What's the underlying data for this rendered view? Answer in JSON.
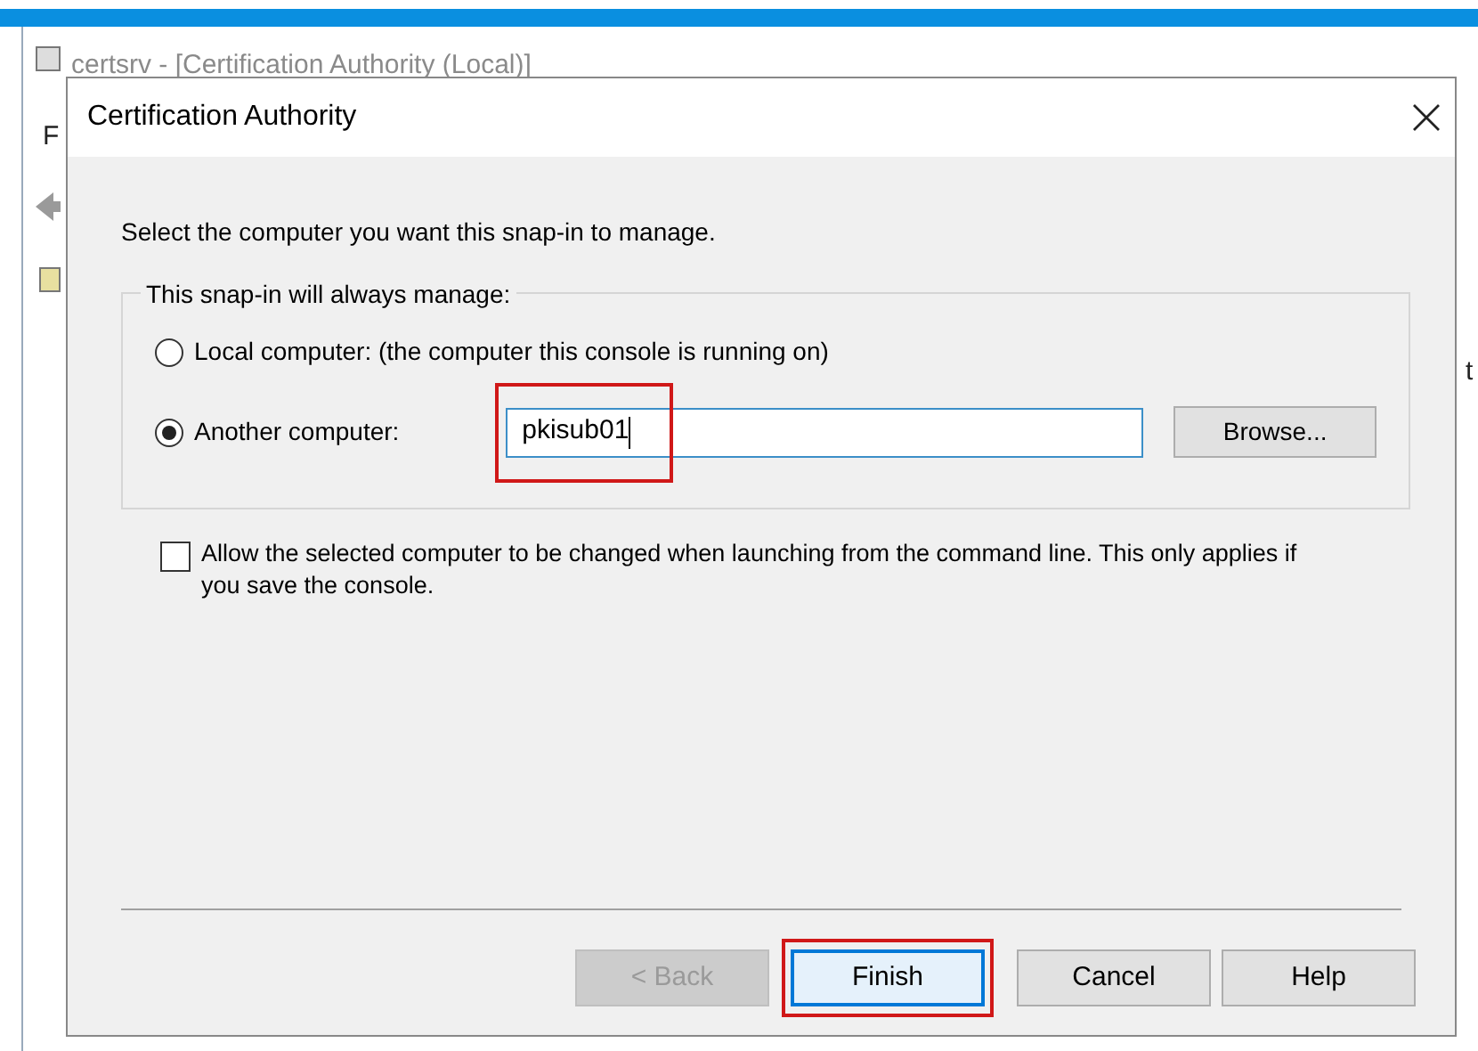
{
  "background_window": {
    "title": "certsrv - [Certification Authority (Local)]",
    "menu_fragment": "F",
    "column_3": "t"
  },
  "dialog": {
    "title": "Certification Authority",
    "intro": "Select the computer you want this snap-in to manage.",
    "group_label": "This snap-in will always manage:",
    "options": [
      {
        "kind": "plain",
        "label": "Local computer:  (the computer this console is running on)",
        "selected": false
      },
      {
        "kind": "with_field",
        "label": "Another computer:",
        "selected": true,
        "value": "pkisub01",
        "button": "Browse..."
      }
    ],
    "allow_change": {
      "label": "Allow the selected computer to be changed when launching from the command line. This only applies if you save the console.",
      "checked": false
    },
    "buttons": [
      {
        "label": "< Back",
        "disabled": true,
        "focused": false,
        "highlighted": false
      },
      {
        "label": "Finish",
        "disabled": false,
        "focused": true,
        "highlighted": true
      },
      {
        "label": "Cancel",
        "disabled": false,
        "focused": false,
        "highlighted": false
      },
      {
        "label": "Help",
        "disabled": false,
        "focused": false,
        "highlighted": false
      }
    ]
  }
}
